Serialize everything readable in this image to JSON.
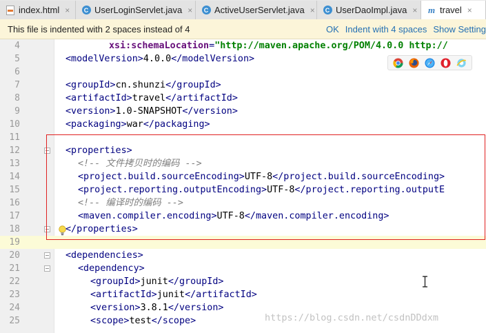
{
  "tabs": [
    {
      "label": "index.html",
      "icon": "html-file-icon"
    },
    {
      "label": "UserLoginServlet.java",
      "icon": "java-class-icon"
    },
    {
      "label": "ActiveUserServlet.java",
      "icon": "java-class-icon"
    },
    {
      "label": "UserDaoImpl.java",
      "icon": "java-class-icon"
    },
    {
      "label": "travel",
      "icon": "maven-icon",
      "active": true
    }
  ],
  "tab_close_glyph": "×",
  "notice": {
    "message": "This file is indented with 2 spaces instead of 4",
    "actions": [
      "OK",
      "Indent with 4 spaces",
      "Show Settings"
    ]
  },
  "lines": {
    "n4": "4",
    "n5": "5",
    "n6": "6",
    "n7": "7",
    "n8": "8",
    "n9": "9",
    "n10": "10",
    "n11": "11",
    "n12": "12",
    "n13": "13",
    "n14": "14",
    "n15": "15",
    "n16": "16",
    "n17": "17",
    "n18": "18",
    "n19": "19",
    "n20": "20",
    "n21": "21",
    "n22": "22",
    "n23": "23",
    "n24": "24",
    "n25": "25"
  },
  "code": {
    "l4_attr": "xsi:schemaLocation",
    "l4_val": "\"http://maven.apache.org/POM/4.0.0 http://",
    "l5_open": "<modelVersion>",
    "l5_text": "4.0.0",
    "l5_close": "</modelVersion>",
    "l7_open": "<groupId>",
    "l7_text": "cn.shunzi",
    "l7_close": "</groupId>",
    "l8_open": "<artifactId>",
    "l8_text": "travel",
    "l8_close": "</artifactId>",
    "l9_open": "<version>",
    "l9_text": "1.0-SNAPSHOT",
    "l9_close": "</version>",
    "l10_open": "<packaging>",
    "l10_text": "war",
    "l10_close": "</packaging>",
    "l12": "<properties>",
    "l13": "<!-- 文件拷贝时的编码 -->",
    "l14_open": "<project.build.sourceEncoding>",
    "l14_text": "UTF-8",
    "l14_close": "</project.build.sourceEncoding>",
    "l15_open": "<project.reporting.outputEncoding>",
    "l15_text": "UTF-8",
    "l15_close": "</project.reporting.outputE",
    "l16": "<!-- 编译时的编码 -->",
    "l17_open": "<maven.compiler.encoding>",
    "l17_text": "UTF-8",
    "l17_close": "</maven.compiler.encoding>",
    "l18": "</properties>",
    "l20": "<dependencies>",
    "l21": "<dependency>",
    "l22_open": "<groupId>",
    "l22_text": "junit",
    "l22_close": "</groupId>",
    "l23_open": "<artifactId>",
    "l23_text": "junit",
    "l23_close": "</artifactId>",
    "l24_open": "<version>",
    "l24_text": "3.8.1",
    "l24_close": "</version>",
    "l25_open": "<scope>",
    "l25_text": "test",
    "l25_close": "</scope>"
  },
  "browser_icons": [
    "chrome-icon",
    "firefox-icon",
    "safari-icon",
    "opera-icon",
    "ie-icon"
  ],
  "colors": {
    "tag": "#000080",
    "attr": "#660e7a",
    "string": "#008000",
    "comment": "#808080",
    "highlight_box": "#e02020",
    "notice_bg": "#fcf5d9",
    "link": "#2470b3"
  },
  "watermark": "https://blog.csdn.net/csdnDDdxm"
}
